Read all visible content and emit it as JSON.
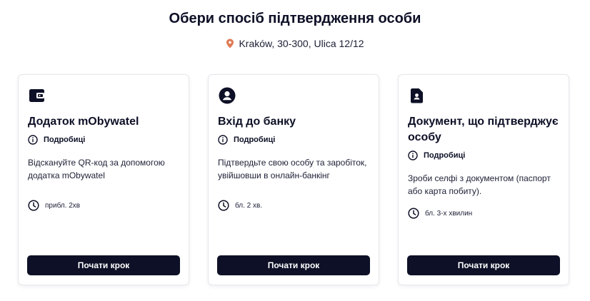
{
  "header": {
    "title": "Обери спосіб підтвердження особи",
    "location_text": "Kraków, 30-300, Ulica 12/12",
    "location_icon": "map-pin-icon",
    "accent_color": "#e07a55"
  },
  "cards": [
    {
      "icon": "wallet-icon",
      "title": "Додаток mObywatel",
      "details_label": "Подробиці",
      "description": "Відскануйте QR-код за допомогою додатка mObywatel",
      "time": "прибл. 2хв",
      "button": "Почати крок"
    },
    {
      "icon": "user-circle-icon",
      "title": "Вхід до банку",
      "details_label": "Подробиці",
      "description": "Підтвердьте свою особу та заробіток, увійшовши в онлайн-банкінг",
      "time": "бл. 2 хв.",
      "button": "Почати крок"
    },
    {
      "icon": "id-document-icon",
      "title": "Документ, що підтверджує особу",
      "details_label": "Подробиці",
      "description": "Зроби селфі з документом (паспорт або карта побиту).",
      "time": "бл. 3-х хвилин",
      "button": "Почати крок"
    }
  ],
  "colors": {
    "primary_dark": "#0d1026",
    "card_border": "#e6e7ec"
  }
}
